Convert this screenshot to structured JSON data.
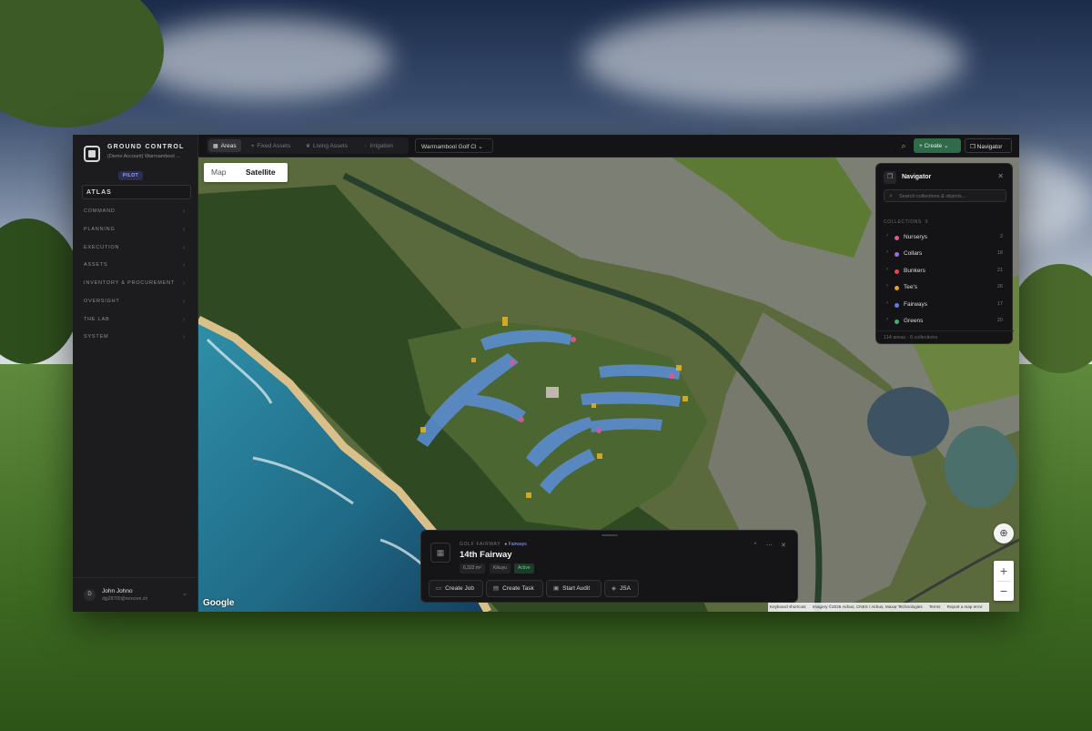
{
  "colors": {
    "accent_green": "#2f6a4a",
    "pilot_badge": "#9aa8ff",
    "active_status": "#5fd38a",
    "fairway_overlay": "#5b8fd8",
    "tee_overlay": "#e0b020"
  },
  "sidebar": {
    "brand": "GROUND CONTROL",
    "account": "(Demo Account) Warrnambool ...",
    "badge": "PILOT",
    "section": "ATLAS",
    "items": [
      {
        "label": "COMMAND",
        "icon": "chevron-right-icon"
      },
      {
        "label": "PLANNING",
        "icon": "chevron-right-icon"
      },
      {
        "label": "EXECUTION",
        "icon": "chevron-right-icon"
      },
      {
        "label": "ASSETS",
        "icon": "chevron-right-icon"
      },
      {
        "label": "INVENTORY & PROCUREMENT",
        "icon": "chevron-right-icon"
      },
      {
        "label": "OVERSIGHT",
        "icon": "chevron-right-icon"
      },
      {
        "label": "THE LAB",
        "icon": "chevron-right-icon"
      },
      {
        "label": "SYSTEM",
        "icon": "chevron-right-icon"
      }
    ],
    "user": {
      "initial": "D",
      "name": "John Johno",
      "email": "djg28700@nexcore.ch"
    }
  },
  "topbar": {
    "tabs": [
      {
        "label": "Areas",
        "icon": "grid-icon",
        "active": true
      },
      {
        "label": "Fixed Assets",
        "icon": "pin-icon",
        "active": false
      },
      {
        "label": "Living Assets",
        "icon": "leaf-icon",
        "active": false
      },
      {
        "label": "Irrigation",
        "icon": "drop-icon",
        "active": false
      }
    ],
    "course_select": "Warrnambool Golf Cl",
    "create_label": "+ Create",
    "navigator_label": "Navigator"
  },
  "map": {
    "type_options": [
      "Map",
      "Satellite"
    ],
    "selected_type": "Satellite",
    "google_label": "Google",
    "attribution": [
      "Keyboard shortcuts",
      "Imagery ©2026 Airbus, CNES / Airbus, Maxar Technologies",
      "Terms",
      "Report a map error"
    ],
    "zoom_in": "+",
    "zoom_out": "−"
  },
  "navigator": {
    "title": "Navigator",
    "search_placeholder": "Search collections & objects...",
    "section_label": "COLLECTIONS",
    "section_count": "6",
    "collections": [
      {
        "name": "Nurserys",
        "count": "2",
        "color": "#e0559a"
      },
      {
        "name": "Collars",
        "count": "18",
        "color": "#9b6cf0"
      },
      {
        "name": "Bunkers",
        "count": "21",
        "color": "#e04a4a"
      },
      {
        "name": "Tee's",
        "count": "26",
        "color": "#e8a020"
      },
      {
        "name": "Fairways",
        "count": "17",
        "color": "#4a86e8"
      },
      {
        "name": "Greens",
        "count": "20",
        "color": "#35b86a"
      }
    ],
    "footer_areas": "114 areas",
    "footer_collections": "6 collections"
  },
  "card": {
    "kicker": "GOLF FAIRWAY",
    "collection": "Fairways",
    "title": "14th Fairway",
    "area": "6,322 m²",
    "species": "Kikuyu",
    "status": "Active",
    "actions": [
      {
        "label": "Create Job",
        "icon": "briefcase-icon"
      },
      {
        "label": "Create Task",
        "icon": "clipboard-icon"
      },
      {
        "label": "Start Audit",
        "icon": "clipboard-check-icon"
      },
      {
        "label": "JSA",
        "icon": "shield-icon"
      }
    ]
  }
}
